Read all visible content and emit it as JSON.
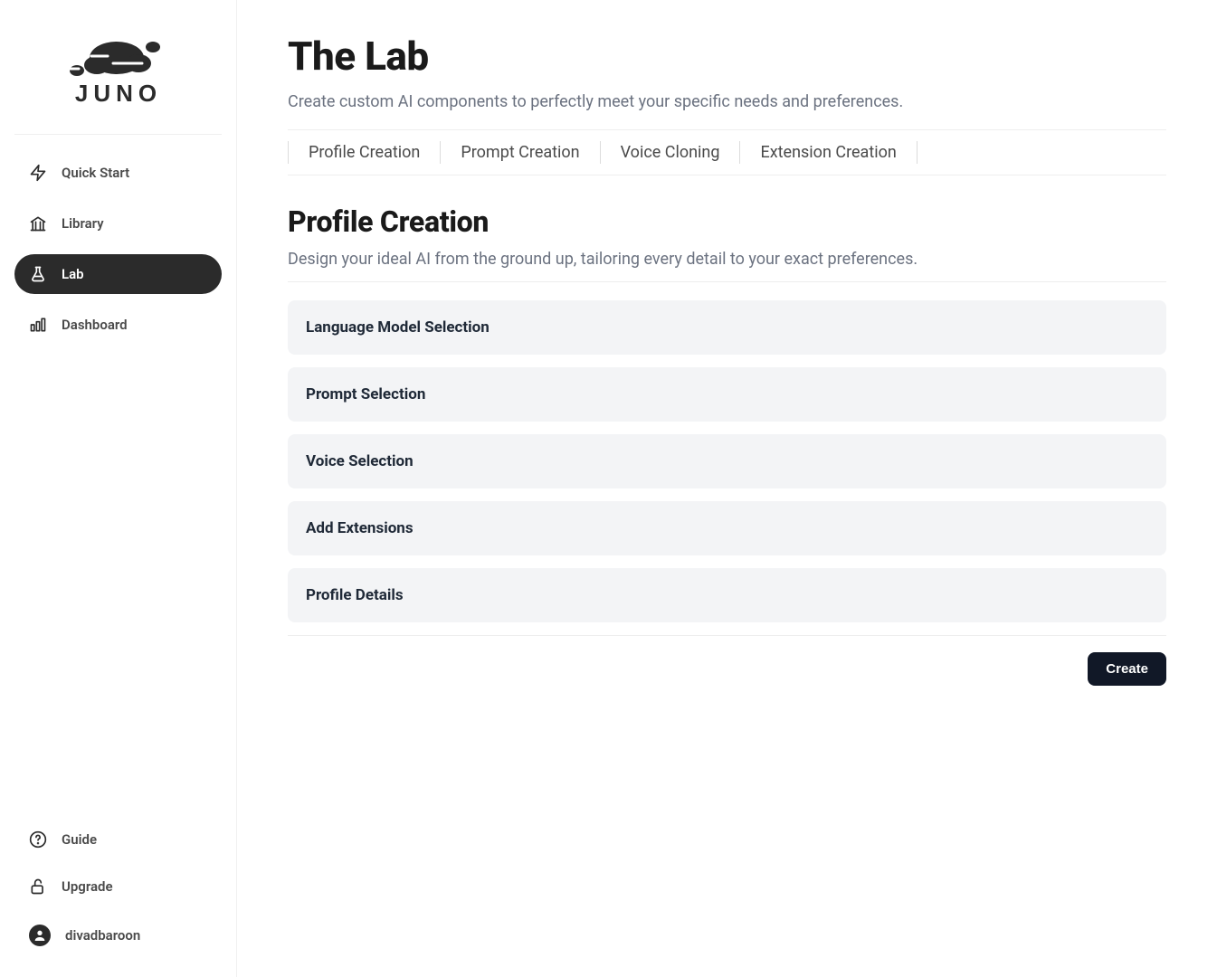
{
  "brand": {
    "name": "JUNO"
  },
  "sidebar": {
    "items": [
      {
        "id": "quickstart",
        "label": "Quick Start",
        "icon": "lightning-icon",
        "active": false
      },
      {
        "id": "library",
        "label": "Library",
        "icon": "library-icon",
        "active": false
      },
      {
        "id": "lab",
        "label": "Lab",
        "icon": "flask-icon",
        "active": true
      },
      {
        "id": "dashboard",
        "label": "Dashboard",
        "icon": "bars-icon",
        "active": false
      }
    ],
    "bottom": [
      {
        "id": "guide",
        "label": "Guide",
        "icon": "help-icon"
      },
      {
        "id": "upgrade",
        "label": "Upgrade",
        "icon": "unlock-icon"
      }
    ],
    "user": {
      "username": "divadbaroon"
    }
  },
  "page": {
    "title": "The Lab",
    "subtitle": "Create custom AI components to perfectly meet your specific needs and preferences."
  },
  "tabs": [
    {
      "id": "profile",
      "label": "Profile Creation"
    },
    {
      "id": "prompt",
      "label": "Prompt Creation"
    },
    {
      "id": "voice",
      "label": "Voice Cloning"
    },
    {
      "id": "extension",
      "label": "Extension Creation"
    }
  ],
  "section": {
    "title": "Profile Creation",
    "subtitle": "Design your ideal AI from the ground up, tailoring every detail to your exact preferences."
  },
  "panels": [
    {
      "id": "llm",
      "label": "Language Model Selection"
    },
    {
      "id": "prompt",
      "label": "Prompt Selection"
    },
    {
      "id": "voice",
      "label": "Voice Selection"
    },
    {
      "id": "ext",
      "label": "Add Extensions"
    },
    {
      "id": "details",
      "label": "Profile Details"
    }
  ],
  "actions": {
    "create_label": "Create"
  }
}
